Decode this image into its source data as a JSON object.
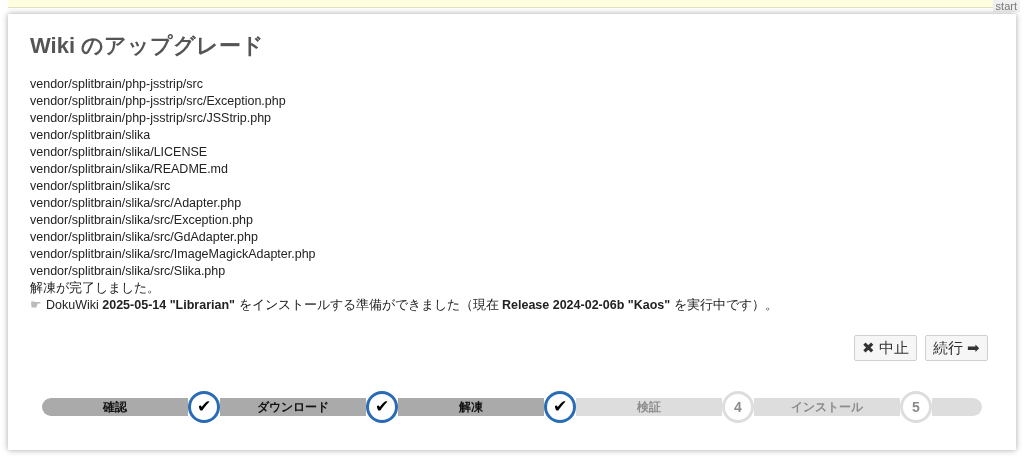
{
  "top_tab": "start",
  "title": "Wiki のアップグレード",
  "log_lines": [
    "vendor/splitbrain/php-jsstrip/src",
    "vendor/splitbrain/php-jsstrip/src/Exception.php",
    "vendor/splitbrain/php-jsstrip/src/JSStrip.php",
    "vendor/splitbrain/slika",
    "vendor/splitbrain/slika/LICENSE",
    "vendor/splitbrain/slika/README.md",
    "vendor/splitbrain/slika/src",
    "vendor/splitbrain/slika/src/Adapter.php",
    "vendor/splitbrain/slika/src/Exception.php",
    "vendor/splitbrain/slika/src/GdAdapter.php",
    "vendor/splitbrain/slika/src/ImageMagickAdapter.php",
    "vendor/splitbrain/slika/src/Slika.php",
    "解凍が完了しました。"
  ],
  "notice": {
    "bullet": "☛",
    "text": "DokuWiki **2025-05-14 \"Librarian\"** をインストールする準備ができました（現在 **Release 2024-02-06b \"Kaos\"** を実行中です）。"
  },
  "buttons": [
    {
      "label": "✖ 中止"
    },
    {
      "label": "続行 ➡"
    }
  ],
  "steps": [
    {
      "label": "確認",
      "done": true,
      "marker": "✔"
    },
    {
      "label": "ダウンロード",
      "done": true,
      "marker": "✔"
    },
    {
      "label": "解凍",
      "done": true,
      "marker": "✔"
    },
    {
      "label": "検証",
      "done": false,
      "marker": "4"
    },
    {
      "label": "インストール",
      "done": false,
      "marker": "5"
    }
  ]
}
